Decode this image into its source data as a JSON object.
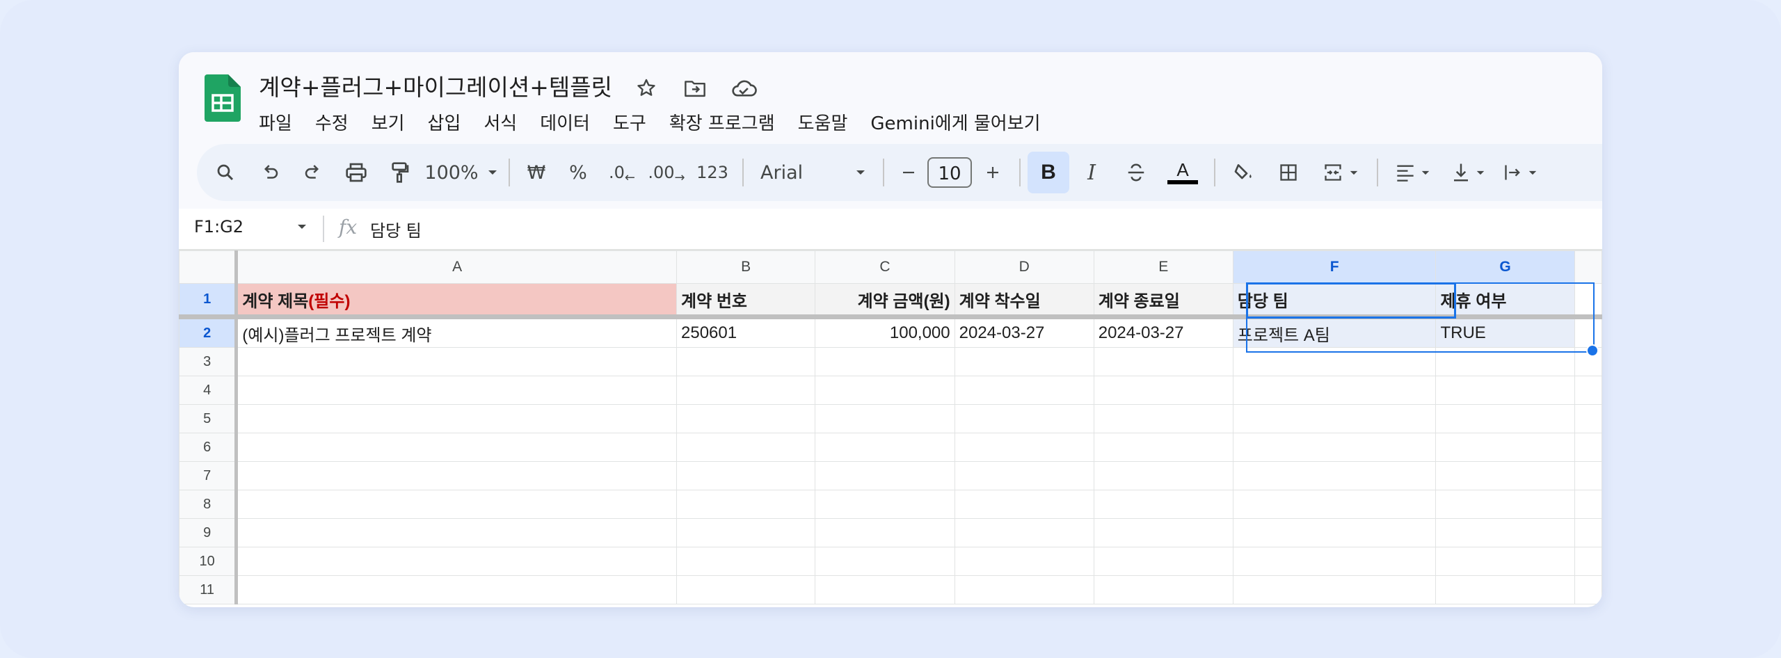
{
  "window": {
    "title": "계약+플러그+마이그레이션+템플릿",
    "accent": "#0b57d0"
  },
  "menu": [
    "파일",
    "수정",
    "보기",
    "삽입",
    "서식",
    "데이터",
    "도구",
    "확장 프로그램",
    "도움말",
    "Gemini에게 물어보기"
  ],
  "toolbar": {
    "zoom": "100%",
    "currency": "₩",
    "percent": "%",
    "dec_decrease": ".0",
    "dec_increase": ".00",
    "number_format": "123",
    "font": "Arial",
    "font_size": "10",
    "icons": [
      "search-icon",
      "undo-icon",
      "redo-icon",
      "print-icon",
      "paint-format-icon",
      "bold-icon",
      "italic-icon",
      "strikethrough-icon",
      "text-color-icon",
      "fill-color-icon",
      "borders-icon",
      "merge-cells-icon",
      "align-left-icon",
      "valign-bottom-icon",
      "text-wrap-icon"
    ]
  },
  "formula_bar": {
    "name_box": "F1:G2",
    "fx": "fx",
    "value": "담당 팀"
  },
  "grid": {
    "columns": [
      "A",
      "B",
      "C",
      "D",
      "E",
      "F",
      "G"
    ],
    "rows": [
      "1",
      "2",
      "3",
      "4",
      "5",
      "6",
      "7",
      "8",
      "9",
      "10",
      "11"
    ],
    "header_row": {
      "a_main": "계약 제목",
      "a_required": "(필수)",
      "b": "계약 번호",
      "c": "계약 금액(원)",
      "d": "계약 착수일",
      "e": "계약 종료일",
      "f": "담당 팀",
      "g": "제휴 여부"
    },
    "row2": {
      "a": "(예시)플러그 프로젝트 계약",
      "b": "250601",
      "c": "100,000",
      "d": "2024-03-27",
      "e": "2024-03-27",
      "f": "프로젝트 A팀",
      "g": "TRUE"
    }
  }
}
